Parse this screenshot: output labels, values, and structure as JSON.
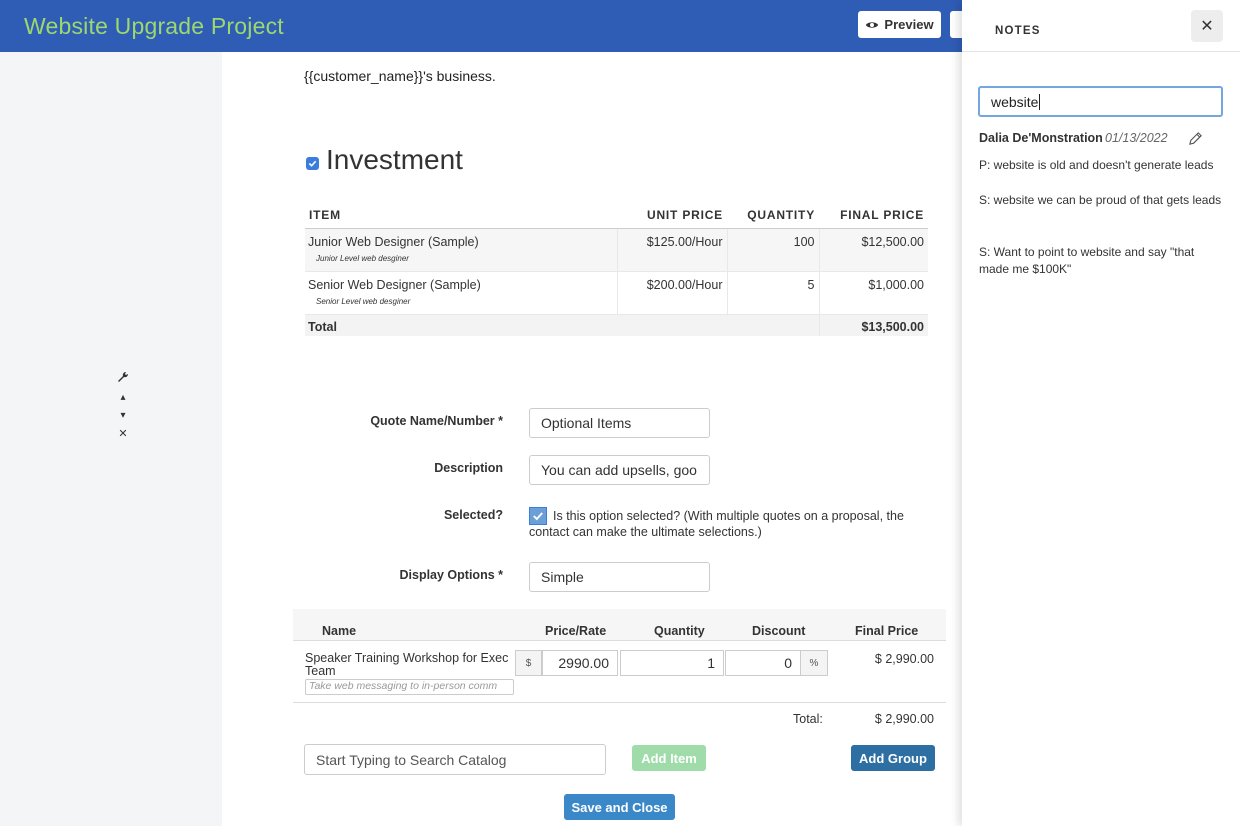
{
  "header": {
    "title": "Website Upgrade Project",
    "preview_label": "Preview"
  },
  "document": {
    "customer_text": "{{customer_name}}'s business.",
    "section_title": "Investment",
    "price_table": {
      "columns": [
        "ITEM",
        "UNIT PRICE",
        "QUANTITY",
        "FINAL PRICE"
      ],
      "rows": [
        {
          "item": "Junior Web Designer (Sample)",
          "sub": "Junior Level web desginer",
          "unit_price": "$125.00/Hour",
          "quantity": "100",
          "final_price": "$12,500.00"
        },
        {
          "item": "Senior Web Designer (Sample)",
          "sub": "Senior Level web desginer",
          "unit_price": "$200.00/Hour",
          "quantity": "5",
          "final_price": "$1,000.00"
        }
      ],
      "total_label": "Total",
      "total_value": "$13,500.00"
    }
  },
  "quote_form": {
    "quote_name_label": "Quote Name/Number *",
    "quote_name_value": "Optional Items",
    "description_label": "Description",
    "description_value": "You can add upsells, goo",
    "selected_label": "Selected?",
    "selected_text": "Is this option selected? (With multiple quotes on a proposal, the contact can make the ultimate selections.)",
    "display_options_label": "Display Options *",
    "display_options_value": "Simple"
  },
  "line_items": {
    "columns": {
      "name": "Name",
      "price": "Price/Rate",
      "quantity": "Quantity",
      "discount": "Discount",
      "final": "Final Price"
    },
    "item": {
      "name": "Speaker Training Workshop for Exec Team",
      "description_placeholder": "Take web messaging to in-person comm",
      "currency": "$",
      "price": "2990.00",
      "quantity": "1",
      "discount": "0",
      "discount_unit": "%",
      "final_price": "$ 2,990.00"
    },
    "total_label": "Total:",
    "total_value": "$ 2,990.00"
  },
  "actions": {
    "search_placeholder": "Start Typing to Search Catalog",
    "add_item": "Add Item",
    "add_group": "Add Group",
    "save_close": "Save and Close"
  },
  "notes": {
    "title": "NOTES",
    "close_glyph": "✕",
    "search_value": "website",
    "author": "Dalia De'Monstration",
    "date": "01/13/2022",
    "lines": [
      "P: website is old and doesn't generate leads",
      "S: website we can be proud of that gets leads",
      "S: Want to point to website and say \"that made me $100K\""
    ]
  },
  "icons": {
    "tools": [
      "wrench-icon",
      "move-up-icon",
      "move-down-icon",
      "remove-icon"
    ]
  },
  "colors": {
    "header_bg": "#2f5cb5",
    "title_green": "#9dd86f",
    "add_group_blue": "#2d6fa3",
    "save_blue": "#3b88c9",
    "add_item_green": "#9fdcaa"
  }
}
